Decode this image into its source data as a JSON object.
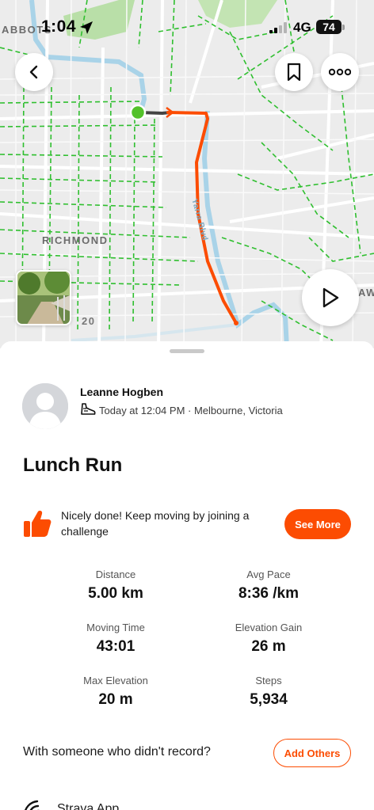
{
  "status_bar": {
    "time": "1:04",
    "network": "4G",
    "battery": "74"
  },
  "map": {
    "labels": {
      "abbots": "ABBOTS",
      "richmond": "RICHMOND",
      "road_number": "20",
      "creek": "Yarra Blvd",
      "edge_text": "AWT"
    },
    "route_color": "#fc4c02",
    "start_color": "#53c12a"
  },
  "athlete": {
    "name": "Leanne Hogben",
    "meta": "Today at 12:04 PM · Melbourne, Victoria"
  },
  "activity": {
    "title": "Lunch Run"
  },
  "promo": {
    "text": "Nicely done! Keep moving by joining a challenge",
    "button_label": "See More"
  },
  "stats": [
    {
      "label": "Distance",
      "value": "5.00 km"
    },
    {
      "label": "Avg Pace",
      "value": "8:36 /km"
    },
    {
      "label": "Moving Time",
      "value": "43:01"
    },
    {
      "label": "Elevation Gain",
      "value": "26 m"
    },
    {
      "label": "Max Elevation",
      "value": "20 m"
    },
    {
      "label": "Steps",
      "value": "5,934"
    }
  ],
  "others": {
    "text": "With someone who didn't record?",
    "button_label": "Add Others"
  },
  "device": {
    "name": "Strava App"
  },
  "colors": {
    "accent": "#fc4c02",
    "trail_green": "#2fbf2f",
    "water": "#a9d3e8",
    "park": "#b9dfa8"
  }
}
